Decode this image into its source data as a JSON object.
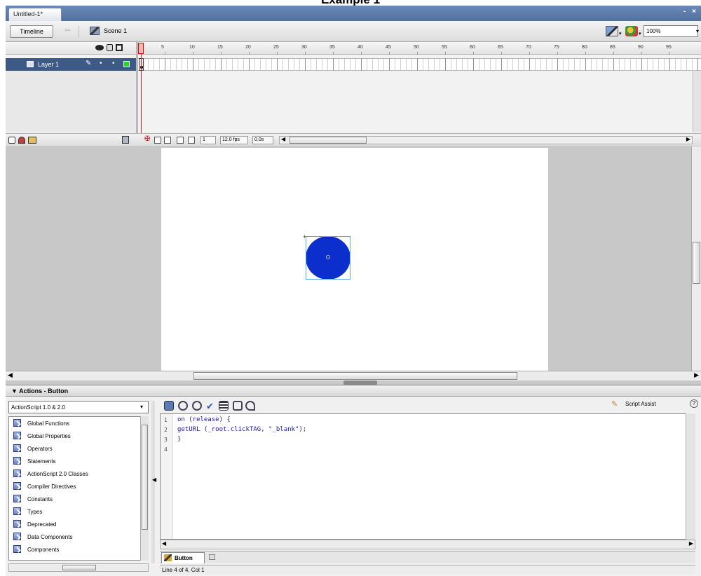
{
  "page": {
    "heading": "Example 1"
  },
  "document": {
    "tab_title": "Untitled-1*",
    "window_controls": "- ×"
  },
  "editbar": {
    "timeline_button": "Timeline",
    "back_arrow": "⇦",
    "scene_label": "Scene 1",
    "zoom_value": "100%",
    "zoom_arrow": "▾"
  },
  "timeline": {
    "ruler_numbers": [
      "1",
      "5",
      "10",
      "15",
      "20",
      "25",
      "30",
      "35",
      "40",
      "45",
      "50",
      "55",
      "60",
      "65",
      "70",
      "75",
      "80",
      "85",
      "90",
      "95"
    ],
    "layer": {
      "name": "Layer 1",
      "edit_icon": "✎",
      "visible_dot": "•",
      "lock_dot": "•",
      "outline_color": "#26d826"
    },
    "footer": {
      "current_frame": "1",
      "frame_rate": "12.0 fps",
      "elapsed_time": "0.0s",
      "center_frame_icon": "✠"
    }
  },
  "stage": {
    "shape_fill": "#0b2ecc",
    "registration_mark": "+"
  },
  "actions": {
    "title": "▼ Actions - Button",
    "language": "ActionScript 1.0 & 2.0",
    "language_arrow": "▾",
    "toolbox": [
      "Global Functions",
      "Global Properties",
      "Operators",
      "Statements",
      "ActionScript 2.0 Classes",
      "Compiler Directives",
      "Constants",
      "Types",
      "Deprecated",
      "Data Components",
      "Components"
    ],
    "script_assist": "Script Assist",
    "script_assist_icon": "✎",
    "help_icon": "?",
    "check_icon": "✔",
    "line_numbers": [
      "1",
      "2",
      "3",
      "4"
    ],
    "code": [
      "on (release) {",
      "getURL (_root.clickTAG, \"_blank\");",
      "}",
      ""
    ],
    "tab_label": "Button",
    "status": "Line 4 of 4, Col 1"
  }
}
